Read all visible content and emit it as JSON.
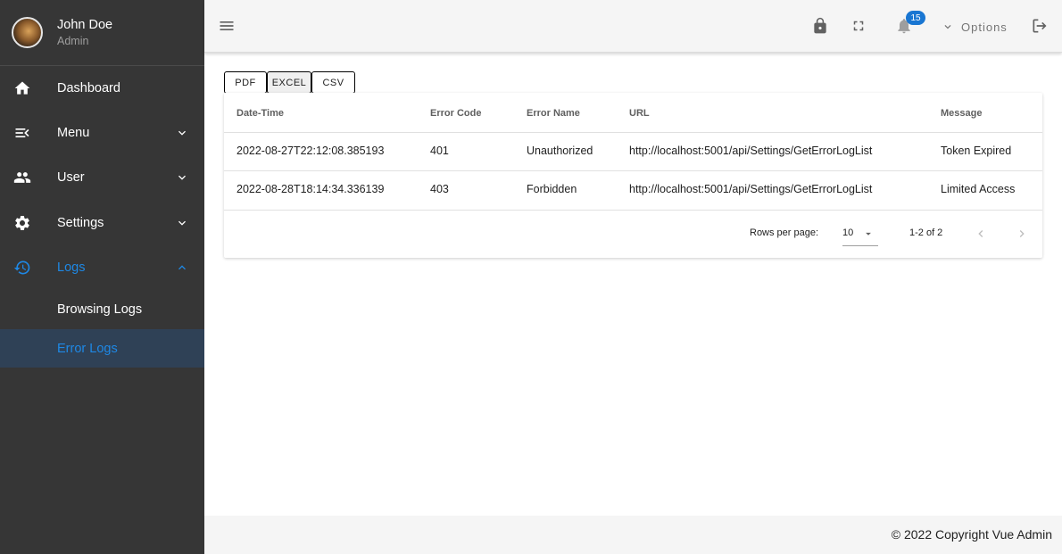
{
  "profile": {
    "name": "John Doe",
    "role": "Admin"
  },
  "nav": {
    "dashboard": "Dashboard",
    "menu": "Menu",
    "user": "User",
    "settings": "Settings",
    "logs": "Logs",
    "browsing_logs": "Browsing Logs",
    "error_logs": "Error Logs"
  },
  "topbar": {
    "notification_count": "15",
    "options_label": "Options"
  },
  "export": {
    "pdf": "PDF",
    "excel": "EXCEL",
    "csv": "CSV"
  },
  "table": {
    "headers": [
      "Date-Time",
      "Error Code",
      "Error Name",
      "URL",
      "Message"
    ],
    "rows": [
      [
        "2022-08-27T22:12:08.385193",
        "401",
        "Unauthorized",
        "http://localhost:5001/api/Settings/GetErrorLogList",
        "Token Expired"
      ],
      [
        "2022-08-28T18:14:34.336139",
        "403",
        "Forbidden",
        "http://localhost:5001/api/Settings/GetErrorLogList",
        "Limited Access"
      ]
    ],
    "rows_per_page_label": "Rows per page:",
    "rows_per_page_value": "10",
    "pagination_text": "1-2 of 2"
  },
  "footer": {
    "copyright": "© 2022 Copyright Vue Admin"
  },
  "colors": {
    "accent": "#1e88e5",
    "sidebar_bg": "#363636",
    "badge": "#1976d2"
  }
}
